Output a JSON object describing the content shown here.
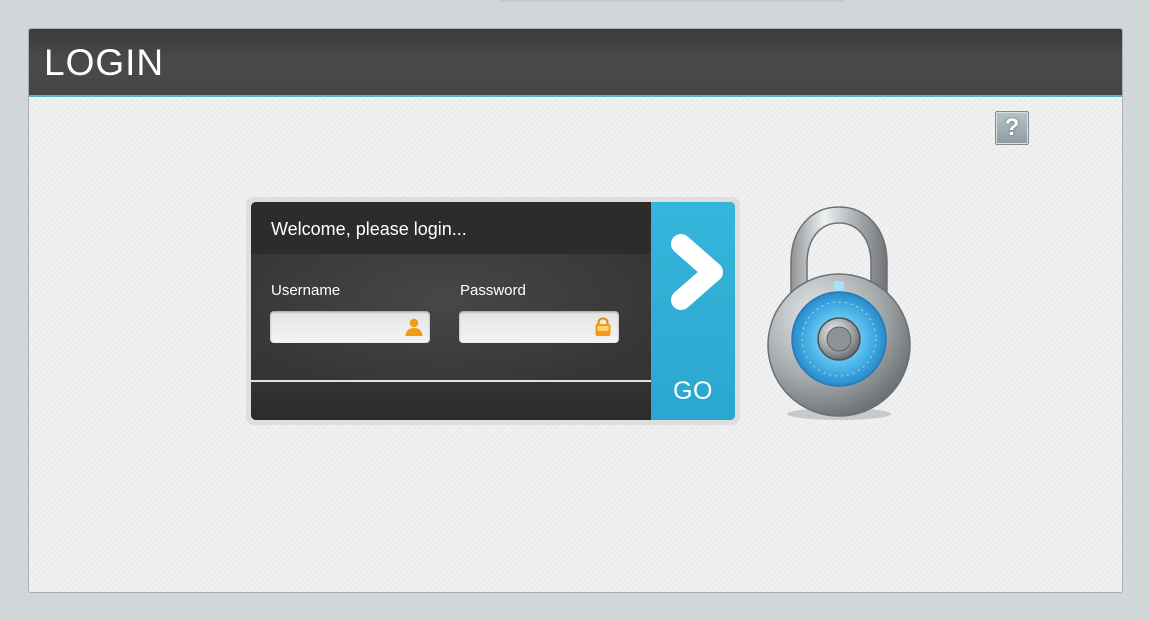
{
  "header": {
    "title": "LOGIN"
  },
  "help": {
    "label": "?",
    "icon": "help-icon"
  },
  "login": {
    "welcome": "Welcome, please login...",
    "username": {
      "label": "Username",
      "value": "",
      "placeholder": "",
      "icon": "user-icon"
    },
    "password": {
      "label": "Password",
      "value": "",
      "placeholder": "",
      "icon": "lock-icon"
    },
    "go_button": {
      "label": "GO",
      "icon": "chevron-right-icon"
    }
  },
  "decoration": {
    "icon": "padlock-icon"
  },
  "colors": {
    "accent": "#33b1d8",
    "header_bg": "#444444",
    "field_icon": "#f29b15"
  }
}
